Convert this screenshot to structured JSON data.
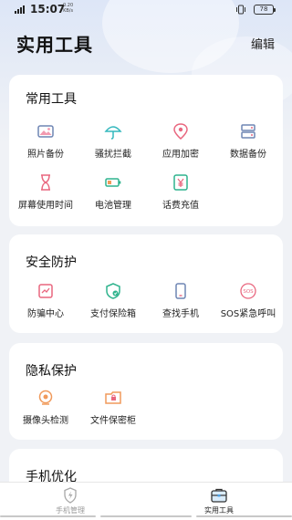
{
  "status_bar": {
    "time": "15:07",
    "net_speed_value": "0.20",
    "net_speed_unit": "KB/s",
    "battery": "78"
  },
  "header": {
    "title": "实用工具",
    "edit_label": "编辑"
  },
  "sections": {
    "common": {
      "title": "常用工具",
      "items": [
        {
          "label": "照片备份",
          "icon": "photo-icon"
        },
        {
          "label": "骚扰拦截",
          "icon": "umbrella-icon"
        },
        {
          "label": "应用加密",
          "icon": "lock-pin-icon"
        },
        {
          "label": "数据备份",
          "icon": "server-icon"
        },
        {
          "label": "屏幕使用时间",
          "icon": "hourglass-icon"
        },
        {
          "label": "电池管理",
          "icon": "battery-icon"
        },
        {
          "label": "话费充值",
          "icon": "yen-icon"
        }
      ]
    },
    "security": {
      "title": "安全防护",
      "items": [
        {
          "label": "防骗中心",
          "icon": "anti-fraud-icon"
        },
        {
          "label": "支付保险箱",
          "icon": "payment-shield-icon"
        },
        {
          "label": "查找手机",
          "icon": "phone-icon"
        },
        {
          "label": "SOS紧急呼叫",
          "icon": "sos-icon"
        }
      ]
    },
    "privacy": {
      "title": "隐私保护",
      "items": [
        {
          "label": "摄像头检测",
          "icon": "camera-icon"
        },
        {
          "label": "文件保密柜",
          "icon": "file-safe-icon"
        }
      ]
    },
    "optimize": {
      "title": "手机优化"
    }
  },
  "bottom_nav": {
    "phone_label": "手机管理",
    "tools_label": "实用工具"
  },
  "colors": {
    "accent_red": "#e9677f",
    "accent_cyan": "#34b8bd",
    "accent_blue": "#6f86b4",
    "accent_green": "#2fb38d",
    "accent_orange": "#f09a5b"
  }
}
